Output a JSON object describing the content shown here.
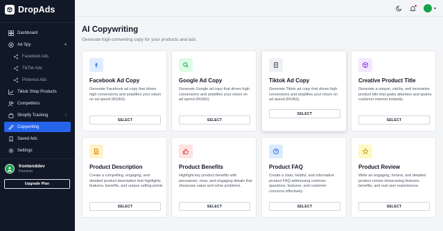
{
  "brand": {
    "name": "DropAds"
  },
  "sidebar": {
    "items": [
      {
        "label": "Dashboard",
        "icon": "home-icon"
      },
      {
        "label": "Ad Spy",
        "icon": "target-icon",
        "expanded": true
      },
      {
        "label": "Facebook Ads",
        "icon": "share-icon",
        "sub": true
      },
      {
        "label": "TikTok Ads",
        "icon": "share-icon",
        "sub": true
      },
      {
        "label": "Pinterest Ads",
        "icon": "share-icon",
        "sub": true
      },
      {
        "label": "Tiktok Shop Products",
        "icon": "chart-icon"
      },
      {
        "label": "Competitors",
        "icon": "users-icon"
      },
      {
        "label": "Shopify Tracking",
        "icon": "bag-icon",
        "expanded": false
      },
      {
        "label": "Copywriting",
        "icon": "pen-icon",
        "active": true
      },
      {
        "label": "Saved Ads",
        "icon": "bookmark-icon"
      },
      {
        "label": "Settings",
        "icon": "gear-icon"
      }
    ]
  },
  "user": {
    "name": "frontenddev",
    "plan": "Premium",
    "upgrade_label": "Upgrade Plan"
  },
  "header": {
    "title": "AI Copywriting",
    "subtitle": "Generate high-converting copy for your products and ads"
  },
  "cards": [
    {
      "title": "Facebook Ad Copy",
      "desc": "Generate Facebook ad copy that drives high conversions and amplifies your return on ad spend (ROAS).",
      "button": "SELECT",
      "icon": "facebook-icon",
      "icon_bg": "#e0ecff",
      "icon_color": "#2563eb"
    },
    {
      "title": "Google Ad Copy",
      "desc": "Generate Google ad copy that drives high conversions and amplifies your return on ad spend (ROAS).",
      "button": "SELECT",
      "icon": "search-icon",
      "icon_bg": "#dcfce7",
      "icon_color": "#16a34a"
    },
    {
      "title": "Tiktok Ad Copy",
      "desc": "Generate Tiktok ad copy that drives high conversions and amplifies your return on ad spend (ROAS).",
      "button": "SELECT",
      "icon": "document-icon",
      "icon_bg": "#eef0f4",
      "icon_color": "#4b5563"
    },
    {
      "title": "Creative Product Title",
      "desc": "Generate a unique, catchy, and innovative product title that grabs attention and sparks customer interest instantly.",
      "button": "SELECT",
      "icon": "cube-icon",
      "icon_bg": "#f3e8ff",
      "icon_color": "#9333ea"
    },
    {
      "title": "Product Description",
      "desc": "Create a compelling, engaging, and detailed product description that highlights features, benefits, and unique selling points",
      "button": "SELECT",
      "icon": "file-text-icon",
      "icon_bg": "#fef3c7",
      "icon_color": "#d97706"
    },
    {
      "title": "Product Benefits",
      "desc": "Highlight key product benefits with persuasive, clear, and engaging details that showcase value and solve problems.",
      "button": "SELECT",
      "icon": "thumbs-up-icon",
      "icon_bg": "#fee2e2",
      "icon_color": "#dc2626"
    },
    {
      "title": "Product FAQ",
      "desc": "Create a clear, helpful, and informative product FAQ addressing common questions, features, and customer concerns effectively.",
      "button": "SELECT",
      "icon": "question-icon",
      "icon_bg": "#dbeafe",
      "icon_color": "#2563eb"
    },
    {
      "title": "Product Review",
      "desc": "Write an engaging, honest, and detailed product review showcasing features, benefits, and real user experiences.",
      "button": "SELECT",
      "icon": "star-icon",
      "icon_bg": "#fef9c3",
      "icon_color": "#ca8a04"
    }
  ]
}
